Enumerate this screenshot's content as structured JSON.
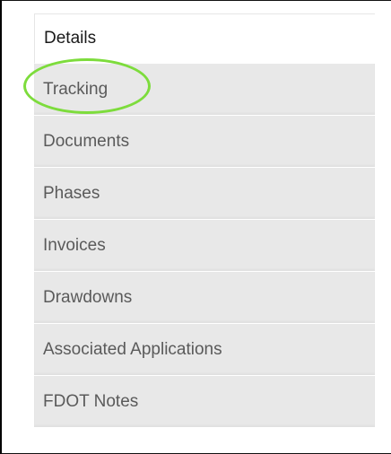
{
  "tabs": [
    {
      "label": "Details",
      "active": true
    },
    {
      "label": "Tracking",
      "active": false
    },
    {
      "label": "Documents",
      "active": false
    },
    {
      "label": "Phases",
      "active": false
    },
    {
      "label": "Invoices",
      "active": false
    },
    {
      "label": "Drawdowns",
      "active": false
    },
    {
      "label": "Associated Applications",
      "active": false
    },
    {
      "label": "FDOT Notes",
      "active": false
    }
  ],
  "annotation": {
    "color": "#7ddc3c",
    "target": "Tracking"
  }
}
